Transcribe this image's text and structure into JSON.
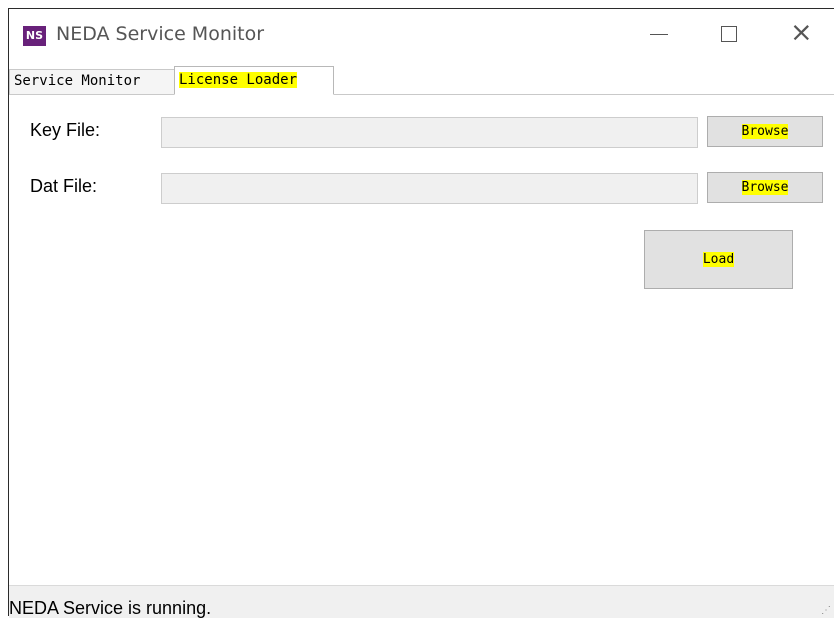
{
  "window": {
    "icon_text": "NS",
    "title": "NEDA Service Monitor",
    "controls": {
      "minimize": "—",
      "maximize": "",
      "close": "×"
    }
  },
  "tabs": [
    {
      "label": "Service Monitor",
      "selected": false
    },
    {
      "label": "License Loader",
      "selected": true
    }
  ],
  "form": {
    "key_file": {
      "label": "Key File:",
      "value": "",
      "button": "Browse"
    },
    "dat_file": {
      "label": "Dat File:",
      "value": "",
      "button": "Browse"
    },
    "load_button": "Load"
  },
  "status_bar": {
    "text": "NEDA Service is running."
  },
  "colors": {
    "highlight": "#ffff00",
    "icon_bg": "#68217a",
    "button_bg": "#e1e1e1"
  }
}
